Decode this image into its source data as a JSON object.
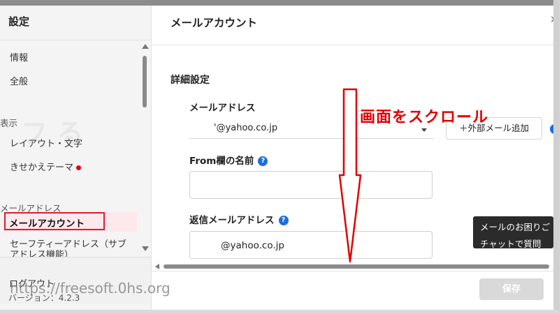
{
  "sidebar": {
    "title": "設定",
    "items": [
      {
        "label": "情報"
      },
      {
        "label": "全般"
      }
    ],
    "sections": [
      {
        "label": "表示",
        "items": [
          {
            "label": "レイアウト・文字"
          },
          {
            "label": "きせかえテーマ"
          }
        ]
      },
      {
        "label": "メールアドレス",
        "items": [
          {
            "label": "メールアカウント"
          },
          {
            "label": "セーフティーアドレス（サブアドレス機能）"
          }
        ]
      }
    ],
    "logout": "ログアウト",
    "version": "バージョン：4.2.3"
  },
  "main": {
    "title": "メールアカウント",
    "section_title": "詳細設定",
    "fields": {
      "email": {
        "label": "メールアドレス",
        "value": "'@yahoo.co.jp"
      },
      "from_name": {
        "label": "From欄の名前",
        "value": ""
      },
      "reply": {
        "label": "返信メールアドレス",
        "value": "@yahoo.co.jp"
      }
    },
    "add_external_button": "＋外部メール追加",
    "save_button": "保存",
    "close_glyph": "×"
  },
  "chat_popup": {
    "line1": "メールのお困りご",
    "line2": "チャットで質問"
  },
  "annotation": {
    "text": "画面をスクロール",
    "color": "#e00000"
  },
  "watermark": "https://freesoft.0hs.org",
  "colors": {
    "accent_red": "#e0182d",
    "help_blue": "#1a6fe0",
    "active_bg": "#fde8ec",
    "save_disabled": "#d9d9d9"
  }
}
